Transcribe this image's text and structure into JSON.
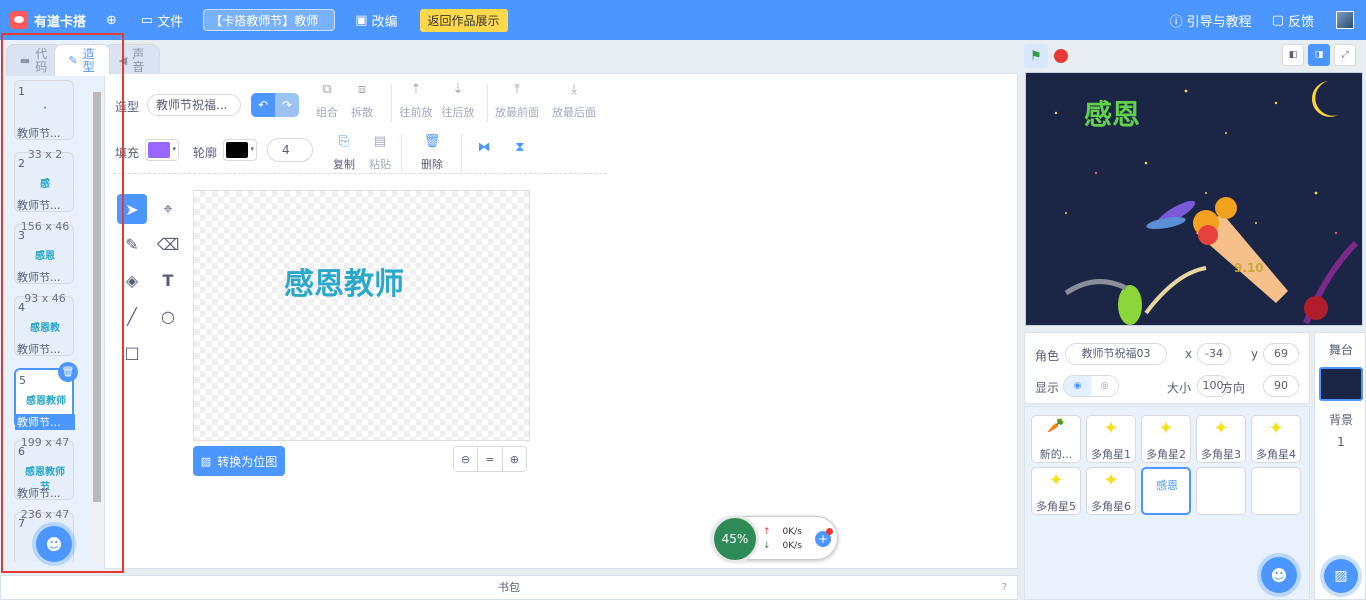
{
  "app": {
    "name": "有道卡搭",
    "project_title": "【卡搭教师节】教师"
  },
  "menu": {
    "globe_icon": "globe-icon",
    "file": "文件",
    "remix": "改编",
    "back_to_gallery": "返回作品展示",
    "guide": "引导与教程",
    "feedback": "反馈"
  },
  "tabs": [
    {
      "label": "代码"
    },
    {
      "label": "造型"
    },
    {
      "label": "声音"
    }
  ],
  "costumes": [
    {
      "num": "1",
      "dim": "",
      "thumb": "·",
      "name": "教师节..."
    },
    {
      "num": "2",
      "dim": "33 x 2",
      "thumb": "感",
      "name": "教师节..."
    },
    {
      "num": "3",
      "dim": "156 x 46",
      "thumb": "感恩",
      "name": "教师节..."
    },
    {
      "num": "4",
      "dim": "93 x 46",
      "thumb": "感恩教",
      "name": "教师节..."
    },
    {
      "num": "5",
      "dim": "",
      "thumb": "感恩教师",
      "name": "教师节..."
    },
    {
      "num": "6",
      "dim": "199 x 47",
      "thumb": "感恩教师节",
      "name": "教师节..."
    },
    {
      "num": "7",
      "dim": "236 x 47",
      "thumb": "",
      "name": ""
    }
  ],
  "editor": {
    "costume_label": "造型",
    "costume_name": "教师节祝福...",
    "fill_label": "填充",
    "fill_color": "#9966ff",
    "outline_label": "轮廓",
    "outline_color": "#000000",
    "outline_width": "4",
    "group": "组合",
    "ungroup": "拆散",
    "forward": "往前放",
    "backward": "往后放",
    "front": "放最前面",
    "back": "放最后面",
    "copy": "复制",
    "paste": "粘贴",
    "delete": "删除",
    "canvas_text": "感恩教师",
    "convert_bitmap": "转换为位图"
  },
  "speed": {
    "percent": "45%",
    "up": "0K/s",
    "down": "0K/s"
  },
  "backpack": {
    "label": "书包",
    "help": "?"
  },
  "stage": {
    "title_text": "感恩",
    "date_text": "9.10"
  },
  "sprite_info": {
    "sprite_label": "角色",
    "sprite_name": "教师节祝福03",
    "x_label": "x",
    "x": "-34",
    "y_label": "y",
    "y": "69",
    "show_label": "显示",
    "size_label": "大小",
    "size": "100",
    "dir_label": "方向",
    "dir": "90"
  },
  "sprites": [
    {
      "name": "新的...",
      "icon": "🥕"
    },
    {
      "name": "多角星1",
      "icon": "✦"
    },
    {
      "name": "多角星2",
      "icon": "✦"
    },
    {
      "name": "多角星3",
      "icon": "✦"
    },
    {
      "name": "多角星4",
      "icon": "✦"
    },
    {
      "name": "多角星5",
      "icon": "✦"
    },
    {
      "name": "多角星6",
      "icon": "✦"
    },
    {
      "name": "感恩",
      "icon": ""
    }
  ],
  "stage_pane": {
    "title": "舞台",
    "backdrop_label": "背景",
    "backdrop_count": "1"
  }
}
